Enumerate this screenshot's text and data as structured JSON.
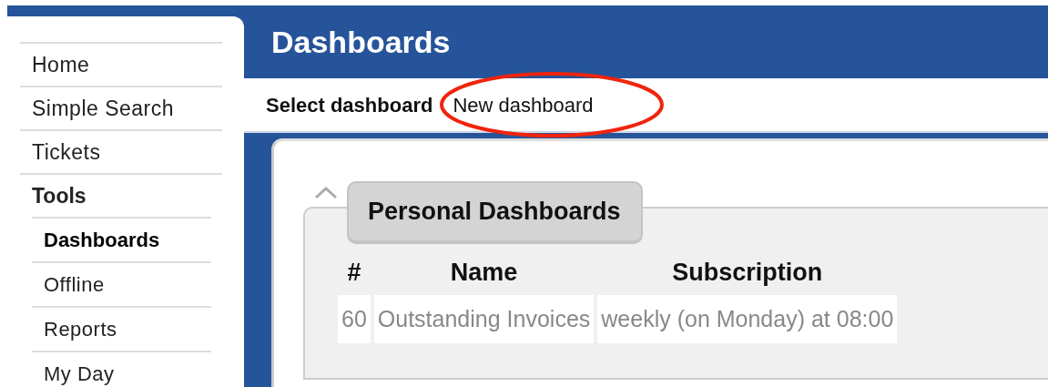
{
  "sidebar": {
    "items": [
      {
        "label": "Home",
        "kind": "item",
        "selected": false
      },
      {
        "label": "Simple Search",
        "kind": "item",
        "selected": false
      },
      {
        "label": "Tickets",
        "kind": "item",
        "selected": false
      },
      {
        "label": "Tools",
        "kind": "section",
        "selected": false,
        "children": [
          {
            "label": "Dashboards",
            "selected": true
          },
          {
            "label": "Offline",
            "selected": false
          },
          {
            "label": "Reports",
            "selected": false
          },
          {
            "label": "My Day",
            "selected": false
          }
        ]
      }
    ]
  },
  "page": {
    "title": "Dashboards"
  },
  "toolbar": {
    "label": "Select dashboard",
    "link": {
      "label": "New dashboard",
      "highlighted": true
    }
  },
  "panel": {
    "title": "Personal Dashboards",
    "expanded": true,
    "table": {
      "columns": [
        "#",
        "Name",
        "Subscription"
      ],
      "rows": [
        [
          "60",
          "Outstanding Invoices",
          "weekly (on Monday) at 08:00"
        ]
      ]
    }
  }
}
